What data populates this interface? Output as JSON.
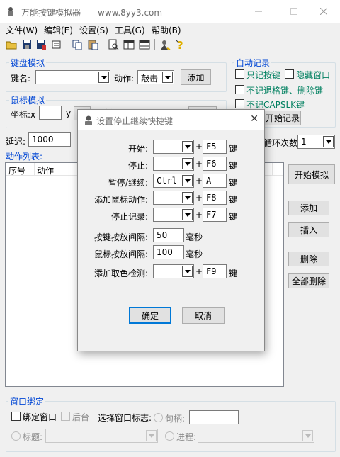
{
  "window": {
    "title": "万能按键模拟器——www.8yy3.com"
  },
  "menu": [
    "文件(W)",
    "编辑(E)",
    "设置(S)",
    "工具(G)",
    "帮助(B)"
  ],
  "toolbar_icons": [
    "open-folder-icon",
    "save-icon",
    "save-as-icon",
    "properties-icon",
    "copy-icon",
    "paste-icon",
    "preview-icon",
    "window-icon",
    "window-alt-icon",
    "wizard-icon",
    "help-icon"
  ],
  "keyboard_group": {
    "title": "键盘模拟",
    "key_label": "键名:",
    "key_value": "",
    "action_label": "动作:",
    "action_value": "敲击",
    "add_button": "添加"
  },
  "mouse_group": {
    "title": "鼠标模拟",
    "coord_label": "坐标:x",
    "y_label": "y",
    "action_label_partial": "动作",
    "add_button_partial": "添"
  },
  "auto_record": {
    "title": "自动记录",
    "only_keys": "只记按键",
    "hide_window": "隐藏窗口",
    "no_backspace": "不记退格键、删除键",
    "no_capslock": "不记CAPSLK键",
    "start_button": "开始记录"
  },
  "delay": {
    "label": "延迟:",
    "value": "1000"
  },
  "loop": {
    "label_partial": "循环次数:",
    "value": "1"
  },
  "action_list": {
    "title": "动作列表:",
    "columns": [
      "序号",
      "动作"
    ]
  },
  "right_buttons": {
    "start_sim": "开始模拟",
    "add": "添加",
    "insert": "插入",
    "delete": "删除",
    "delete_all": "全部删除"
  },
  "window_bind": {
    "title": "窗口绑定",
    "bind_window": "绑定窗口",
    "background": "后台",
    "select_label": "选择窗口标志:",
    "handle": "句柄:",
    "handle_value": "",
    "title_label": "标题:",
    "process_label": "进程:"
  },
  "dialog": {
    "title": "设置停止继续快捷键",
    "rows": [
      {
        "label": "开始:",
        "combo": "",
        "key": "F5",
        "suffix": "键"
      },
      {
        "label": "停止:",
        "combo": "",
        "key": "F6",
        "suffix": "键"
      },
      {
        "label": "暂停/继续:",
        "combo": "Ctrl",
        "key": "A",
        "suffix": "键"
      },
      {
        "label": "添加鼠标动作:",
        "combo": "",
        "key": "F8",
        "suffix": "键"
      },
      {
        "label": "停止记录:",
        "combo": "",
        "key": "F7",
        "suffix": "键"
      }
    ],
    "plus": "+",
    "key_interval_label": "按键按放间隔:",
    "key_interval_value": "50",
    "mouse_interval_label": "鼠标按放间隔:",
    "mouse_interval_value": "100",
    "ms": "毫秒",
    "color_detect": {
      "label": "添加取色检测:",
      "combo": "",
      "key": "F9",
      "suffix": "键"
    },
    "ok": "确定",
    "cancel": "取消"
  },
  "colors": {
    "group_title": "#0046d5",
    "green_text": "#008060",
    "focus": "#0078d7"
  }
}
